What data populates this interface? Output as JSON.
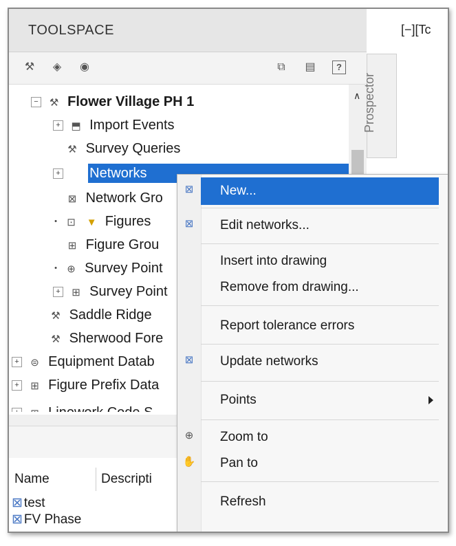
{
  "toolspace": {
    "title": "TOOLSPACE",
    "toolbar": {
      "help_label": "?"
    },
    "prospector_tab": "Prospector",
    "command_line": "[−][Tc"
  },
  "tree": {
    "root": {
      "label": "Flower Village PH 1",
      "expand": "−"
    },
    "items": [
      {
        "label": "Import Events",
        "expand": "+",
        "icon": "import-events-icon"
      },
      {
        "label": "Survey Queries",
        "expand": "",
        "icon": "survey-queries-icon"
      },
      {
        "label": "Networks",
        "expand": "+",
        "icon": "networks-icon",
        "selected": true
      },
      {
        "label": "Network Gro",
        "expand": "",
        "icon": "network-groups-icon"
      },
      {
        "label": "Figures",
        "expand": "•",
        "icon": "figures-icon"
      },
      {
        "label": "Figure Grou",
        "expand": "",
        "icon": "figure-groups-icon"
      },
      {
        "label": "Survey Point",
        "expand": "•",
        "icon": "survey-points-icon"
      },
      {
        "label": "Survey Point",
        "expand": "+",
        "icon": "survey-point-groups-icon"
      },
      {
        "label": "Saddle Ridge",
        "expand": "",
        "icon": "project-icon"
      },
      {
        "label": "Sherwood Fore",
        "expand": "",
        "icon": "project-icon"
      },
      {
        "label": "Equipment Datab",
        "expand": "+",
        "icon": "equipment-db-icon"
      },
      {
        "label": "Figure Prefix Data",
        "expand": "+",
        "icon": "figure-prefix-db-icon"
      },
      {
        "label": "Linework Code S",
        "expand": "+",
        "icon": "linework-icon"
      }
    ]
  },
  "list": {
    "columns": [
      "Name",
      "Descripti"
    ],
    "rows": [
      {
        "name": "test"
      },
      {
        "name": "FV Phase"
      }
    ]
  },
  "context_menu": {
    "new": "New...",
    "edit": "Edit networks...",
    "insert": "Insert into drawing",
    "remove": "Remove from drawing...",
    "report": "Report tolerance errors",
    "update": "Update networks",
    "points": "Points",
    "zoom": "Zoom to",
    "pan": "Pan to",
    "refresh": "Refresh"
  },
  "colors": {
    "selection": "#1f6fd1",
    "accent": "#4a78c4"
  }
}
